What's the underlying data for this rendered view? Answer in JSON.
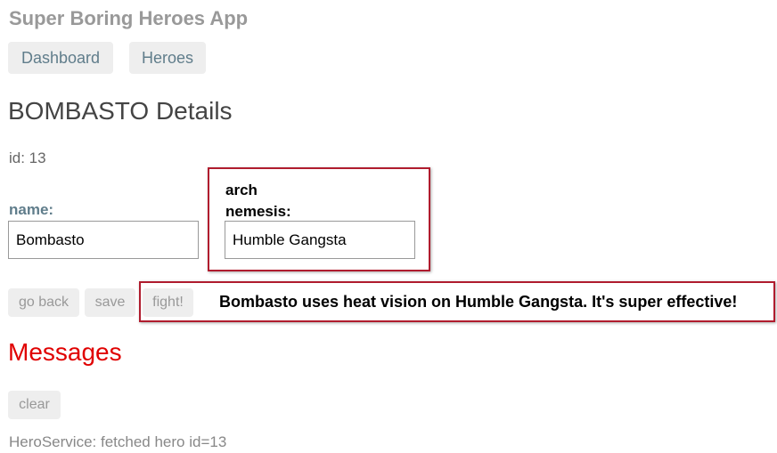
{
  "app": {
    "title": "Super Boring Heroes App"
  },
  "nav": {
    "dashboard": "Dashboard",
    "heroes": "Heroes"
  },
  "hero_detail": {
    "title": "BOMBASTO Details",
    "id_text": "id: 13",
    "name_label": "name:",
    "name_value": "Bombasto",
    "nemesis_label": "arch nemesis:",
    "nemesis_value": "Humble Gangsta"
  },
  "actions": {
    "go_back": "go back",
    "save": "save",
    "fight": "fight!",
    "fight_message": "Bombasto uses heat vision on Humble Gangsta. It's super effective!"
  },
  "messages": {
    "title": "Messages",
    "clear": "clear",
    "items": [
      "HeroService: fetched hero id=13"
    ]
  },
  "colors": {
    "highlight_border": "#b01c2e",
    "messages_title": "#e00000",
    "nav_text": "#607d8b",
    "button_bg": "#eeeeee"
  }
}
